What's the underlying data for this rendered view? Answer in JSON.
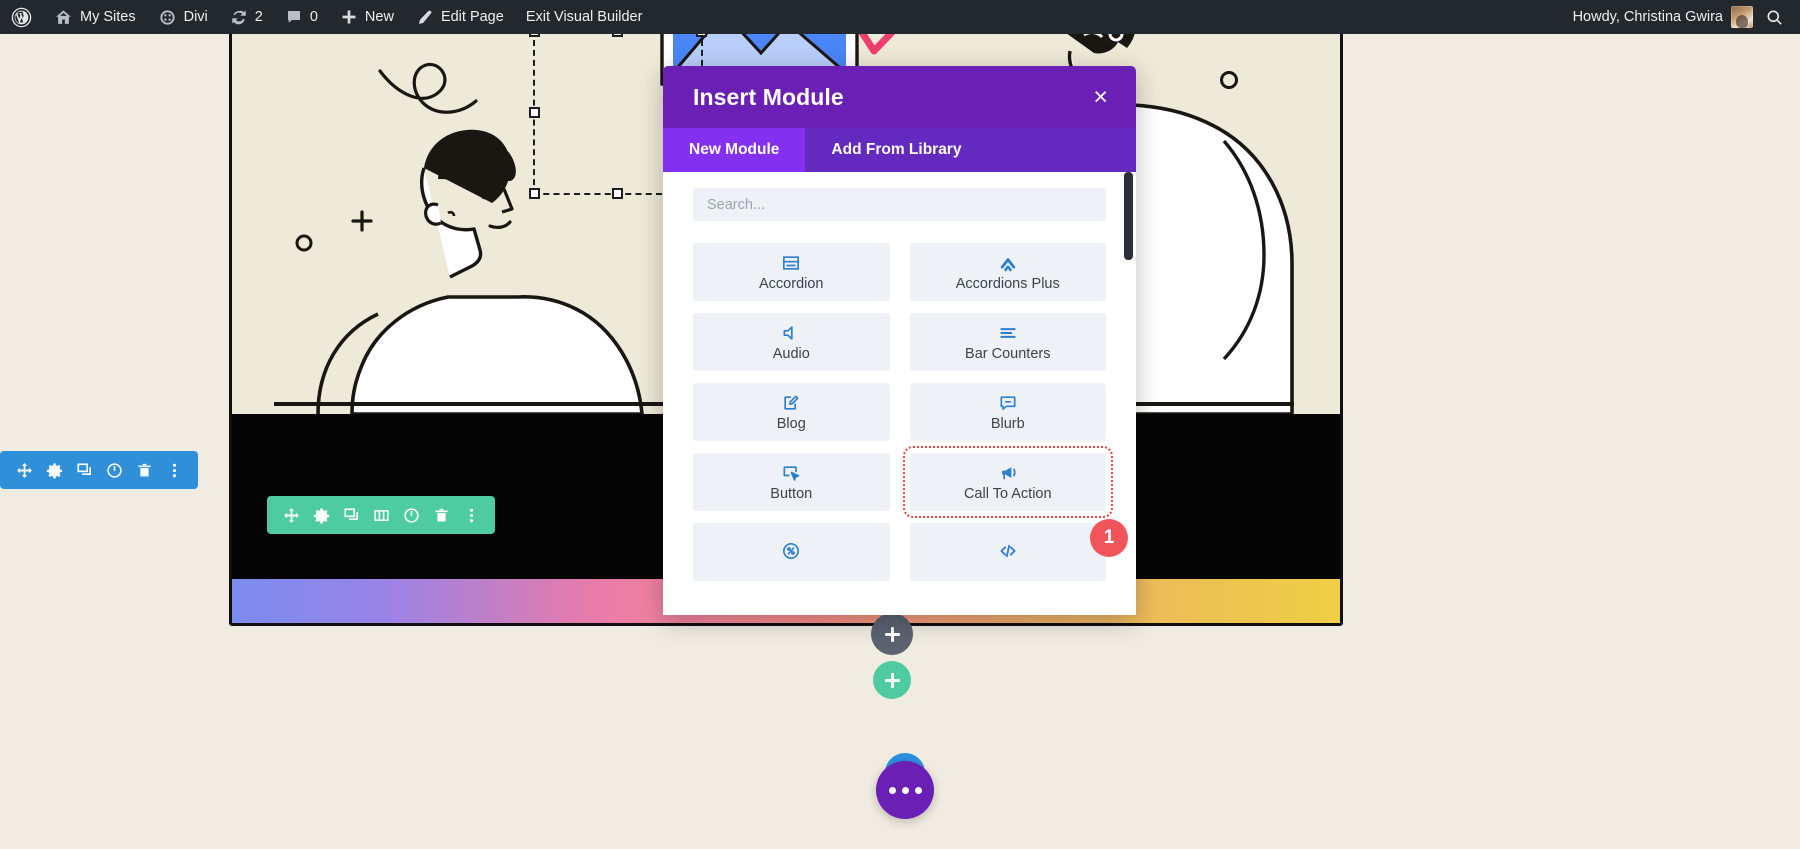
{
  "adminbar": {
    "items": [
      {
        "icon": "wordpress-logo-icon",
        "label": ""
      },
      {
        "icon": "my-sites-icon",
        "label": "My Sites"
      },
      {
        "icon": "divi-icon",
        "label": "Divi"
      },
      {
        "icon": "updates-icon",
        "label": "2"
      },
      {
        "icon": "comments-icon",
        "label": "0"
      },
      {
        "icon": "plus-icon",
        "label": "New"
      },
      {
        "icon": "pencil-icon",
        "label": "Edit Page"
      },
      {
        "icon": "",
        "label": "Exit Visual Builder"
      }
    ],
    "howdy": "Howdy, Christina Gwira",
    "search_icon": "search-icon"
  },
  "modal": {
    "title": "Insert Module",
    "close_label": "×",
    "tabs": [
      {
        "label": "New Module",
        "active": true
      },
      {
        "label": "Add From Library",
        "active": false
      }
    ],
    "search_placeholder": "Search...",
    "search_value": "",
    "modules": [
      {
        "label": "Accordion",
        "icon": "accordion-icon"
      },
      {
        "label": "Accordions Plus",
        "icon": "accordions-plus-icon"
      },
      {
        "label": "Audio",
        "icon": "audio-icon"
      },
      {
        "label": "Bar Counters",
        "icon": "bar-counters-icon"
      },
      {
        "label": "Blog",
        "icon": "blog-icon"
      },
      {
        "label": "Blurb",
        "icon": "blurb-icon"
      },
      {
        "label": "Button",
        "icon": "button-icon"
      },
      {
        "label": "Call To Action",
        "icon": "call-to-action-icon"
      },
      {
        "label": "",
        "icon": "circle-counter-icon"
      },
      {
        "label": "",
        "icon": "code-icon"
      }
    ],
    "highlighted_module": "Call To Action",
    "badge_number": "1",
    "accent_purple": "#6b20b5",
    "tab_active_purple": "#8330f0",
    "badge_color": "#f2545b",
    "module_icon_color": "#2f7fd0"
  },
  "toolbars": {
    "section": {
      "color": "#2f8fd8",
      "buttons": [
        {
          "icon": "move-icon"
        },
        {
          "icon": "gear-icon"
        },
        {
          "icon": "duplicate-icon"
        },
        {
          "icon": "power-icon"
        },
        {
          "icon": "trash-icon"
        },
        {
          "icon": "more-options-icon"
        }
      ]
    },
    "row": {
      "color": "#4ecba1",
      "buttons": [
        {
          "icon": "move-icon"
        },
        {
          "icon": "gear-icon"
        },
        {
          "icon": "duplicate-icon"
        },
        {
          "icon": "columns-icon"
        },
        {
          "icon": "power-icon"
        },
        {
          "icon": "trash-icon"
        },
        {
          "icon": "more-options-icon"
        }
      ]
    }
  },
  "canvas": {
    "add_section_icon": "plus-icon",
    "add_row_icon": "plus-icon",
    "fab_icon": "more-options-icon",
    "hero_bg": "#eeead9",
    "gradient_bar": "linear-gradient blue to yellow"
  }
}
